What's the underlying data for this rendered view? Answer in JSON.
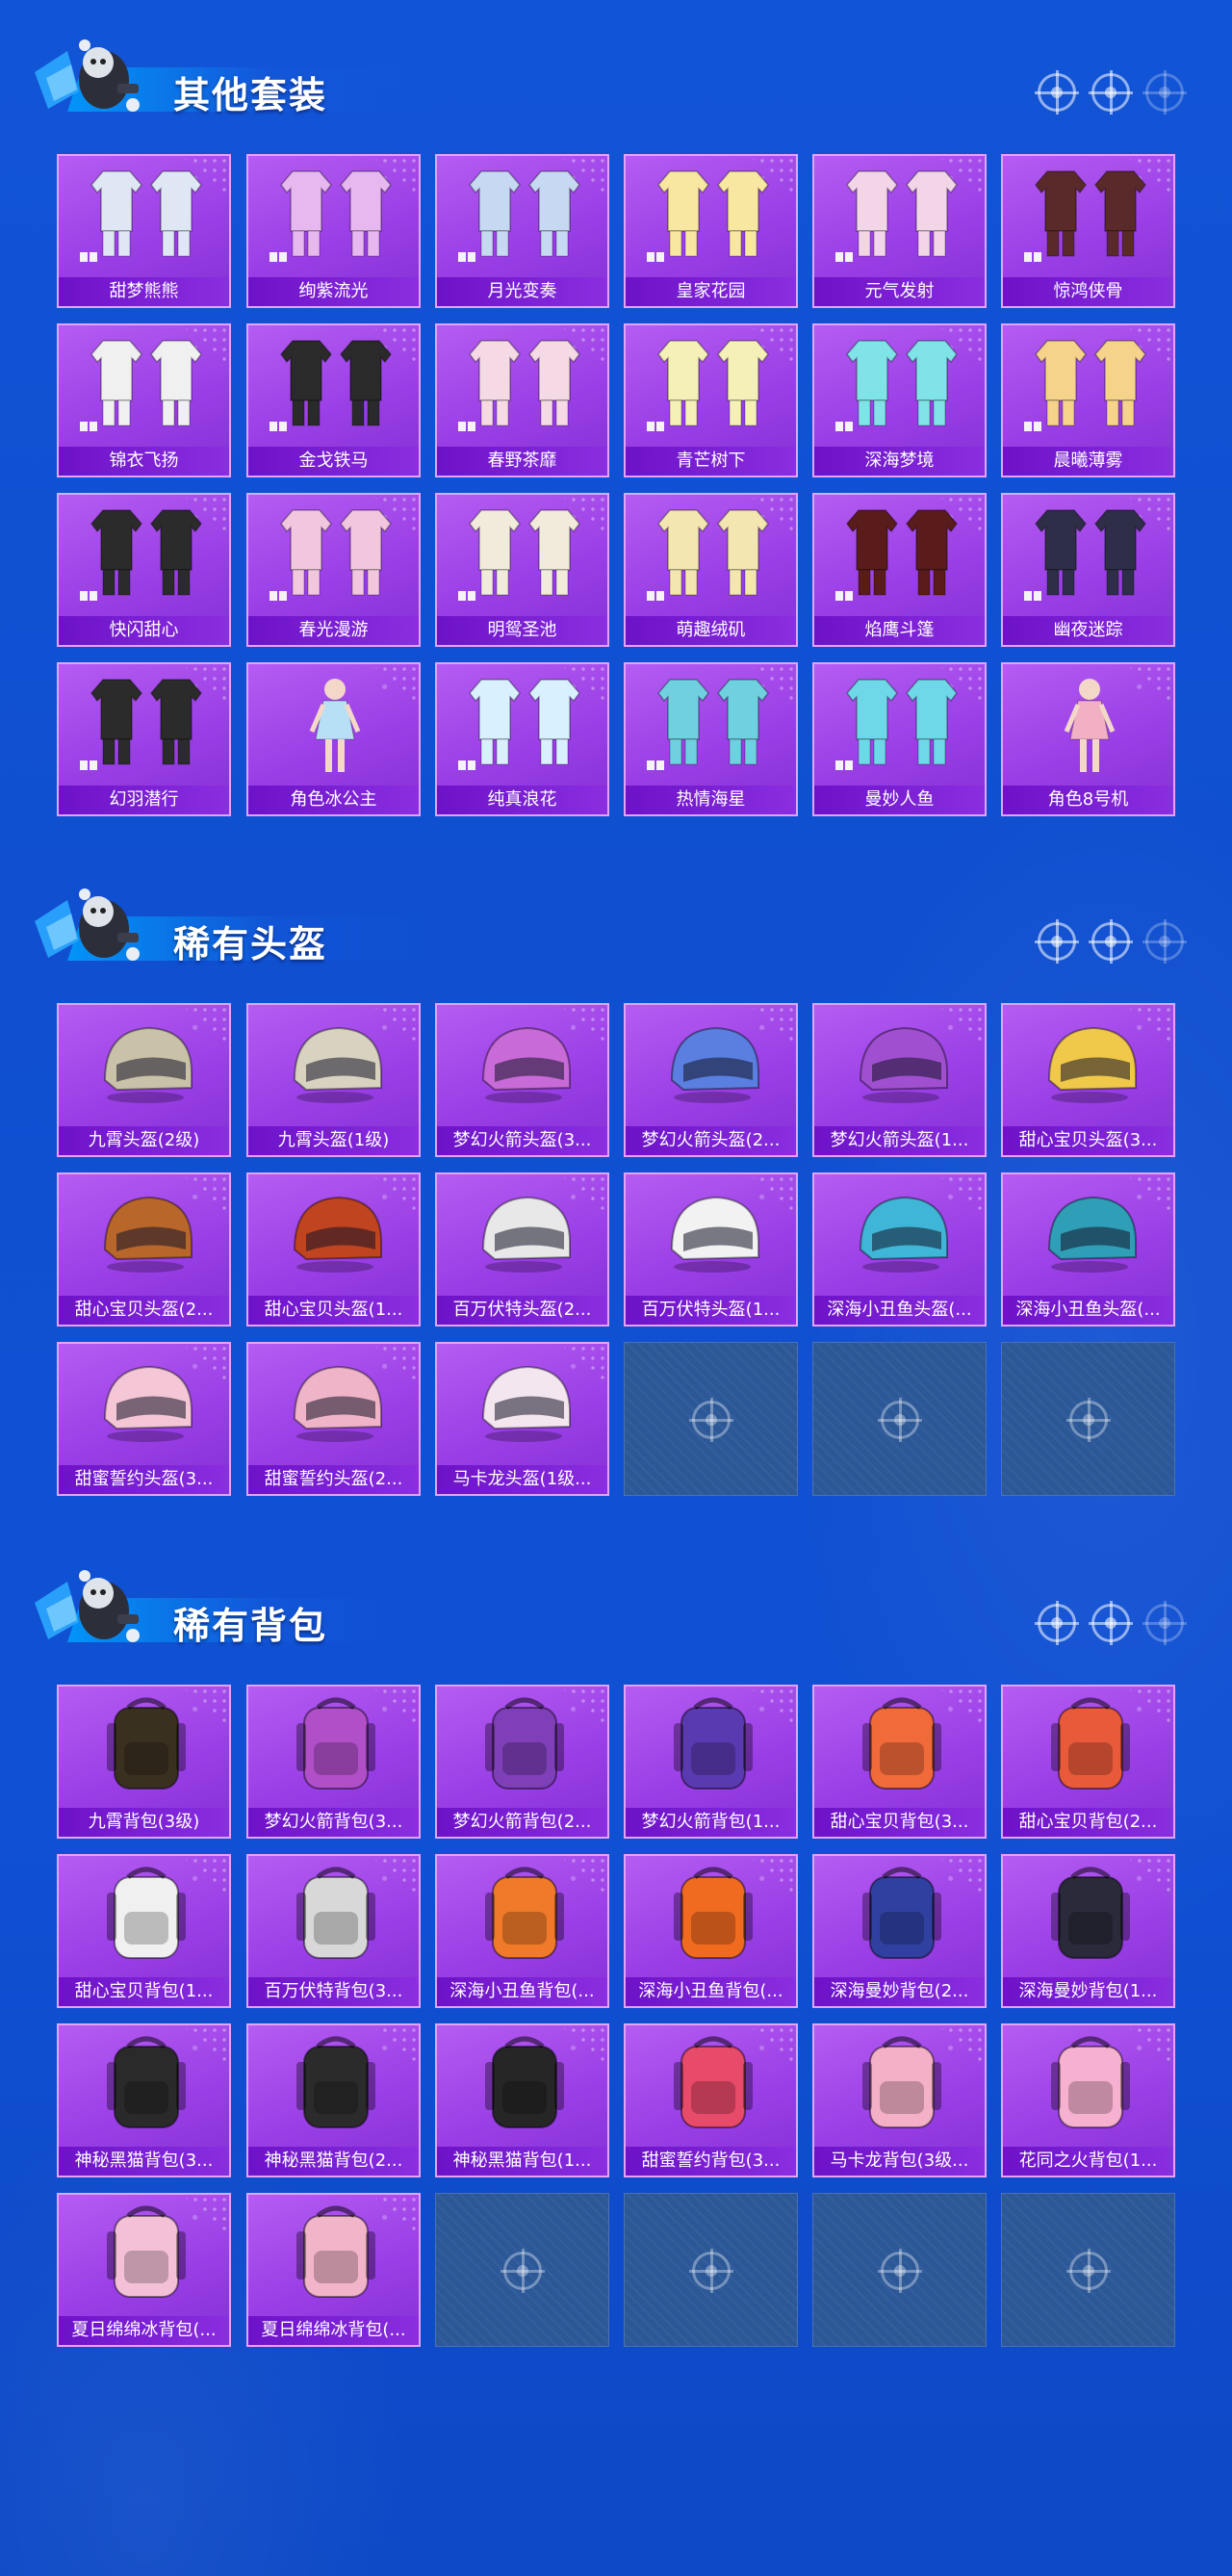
{
  "sections": [
    {
      "title": "其他套装",
      "items": [
        "甜梦熊熊",
        "绚紫流光",
        "月光变奏",
        "皇家花园",
        "元气发射",
        "惊鸿侠骨",
        "锦衣飞扬",
        "金戈铁马",
        "春野茶靡",
        "青芒树下",
        "深海梦境",
        "晨曦薄雾",
        "快闪甜心",
        "春光漫游",
        "明鸳圣池",
        "萌趣绒矶",
        "焰鹰斗篷",
        "幽夜迷踪",
        "幻羽潜行",
        "角色冰公主",
        "纯真浪花",
        "热情海星",
        "曼妙人鱼",
        "角色8号机"
      ],
      "art": [
        "outfit",
        "outfit",
        "outfit",
        "outfit",
        "outfit",
        "outfit",
        "outfit",
        "outfit",
        "outfit",
        "outfit",
        "outfit",
        "outfit",
        "outfit",
        "outfit",
        "outfit",
        "outfit",
        "outfit",
        "outfit",
        "outfit",
        "figure",
        "outfit",
        "outfit",
        "outfit",
        "figure"
      ],
      "colors": [
        "#dfe7f5",
        "#e7b7f0",
        "#c7d8f2",
        "#f7e7a0",
        "#f2d6e8",
        "#5a2a2a",
        "#f0f0f0",
        "#2a2a2a",
        "#f5d9e4",
        "#f4f0b8",
        "#7fe3e8",
        "#f6d38a",
        "#2b2b2b",
        "#f2c7dd",
        "#f1ebdc",
        "#f3e6b0",
        "#5a1b1b",
        "#2e2e48",
        "#2b2b2b",
        "#b7e0f7",
        "#d9f0ff",
        "#6fd0e0",
        "#6fd8e8",
        "#f2b0c4"
      ],
      "empties": 0
    },
    {
      "title": "稀有头盔",
      "items": [
        "九霄头盔(2级)",
        "九霄头盔(1级)",
        "梦幻火箭头盔(3...",
        "梦幻火箭头盔(2...",
        "梦幻火箭头盔(1...",
        "甜心宝贝头盔(3...",
        "甜心宝贝头盔(2...",
        "甜心宝贝头盔(1...",
        "百万伏特头盔(2...",
        "百万伏特头盔(1...",
        "深海小丑鱼头盔(...",
        "深海小丑鱼头盔(...",
        "甜蜜誓约头盔(3...",
        "甜蜜誓约头盔(2...",
        "马卡龙头盔(1级..."
      ],
      "art": [
        "helmet",
        "helmet",
        "helmet",
        "helmet",
        "helmet",
        "helmet",
        "helmet",
        "helmet",
        "helmet",
        "helmet",
        "helmet",
        "helmet",
        "helmet",
        "helmet",
        "helmet"
      ],
      "colors": [
        "#c9c1a8",
        "#d8d2c0",
        "#c86ad8",
        "#5a7fe0",
        "#a04fd0",
        "#f0c84a",
        "#b8662a",
        "#c0441f",
        "#e8e8e8",
        "#f2f2f2",
        "#3fb6d8",
        "#2f9fb8",
        "#f4c6d6",
        "#f0b4c8",
        "#f4e6ee"
      ],
      "empties": 3
    },
    {
      "title": "稀有背包",
      "items": [
        "九霄背包(3级)",
        "梦幻火箭背包(3...",
        "梦幻火箭背包(2...",
        "梦幻火箭背包(1...",
        "甜心宝贝背包(3...",
        "甜心宝贝背包(2...",
        "甜心宝贝背包(1...",
        "百万伏特背包(3...",
        "深海小丑鱼背包(...",
        "深海小丑鱼背包(...",
        "深海曼妙背包(2...",
        "深海曼妙背包(1...",
        "神秘黑猫背包(3...",
        "神秘黑猫背包(2...",
        "神秘黑猫背包(1...",
        "甜蜜誓约背包(3...",
        "马卡龙背包(3级...",
        "花同之火背包(1...",
        "夏日绵绵冰背包(...",
        "夏日绵绵冰背包(..."
      ],
      "art": [
        "bag",
        "bag",
        "bag",
        "bag",
        "bag",
        "bag",
        "bag",
        "bag",
        "bag",
        "bag",
        "bag",
        "bag",
        "bag",
        "bag",
        "bag",
        "bag",
        "bag",
        "bag",
        "bag",
        "bag"
      ],
      "colors": [
        "#3a3020",
        "#b04fc8",
        "#7e3fb8",
        "#5a3ab0",
        "#f06a3a",
        "#e85a3a",
        "#f0f0f0",
        "#d8d8d8",
        "#f07a2a",
        "#f06a20",
        "#3040a0",
        "#2a2a3a",
        "#2a2a2a",
        "#2b2b2b",
        "#262626",
        "#e84a6a",
        "#f4b0c6",
        "#f6b0d0",
        "#f4c0d8",
        "#f2b4c8"
      ],
      "empties": 4
    }
  ]
}
